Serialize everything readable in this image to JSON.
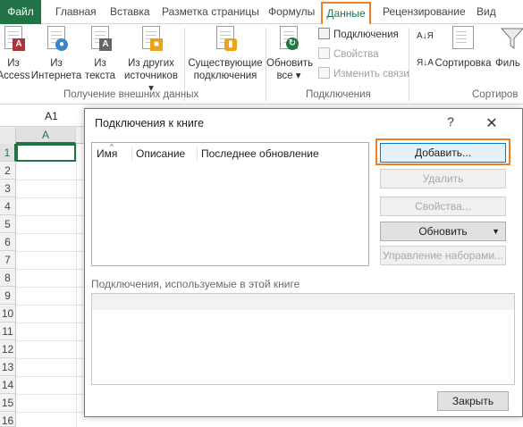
{
  "ribbon_tabs": [
    {
      "label": "Файл"
    },
    {
      "label": "Главная"
    },
    {
      "label": "Вставка"
    },
    {
      "label": "Разметка страницы"
    },
    {
      "label": "Формулы"
    },
    {
      "label": "Данные"
    },
    {
      "label": "Рецензирование"
    },
    {
      "label": "Вид"
    }
  ],
  "ribbon": {
    "external_data": {
      "from_access": {
        "line1": "Из",
        "line2": "Access"
      },
      "from_web": {
        "line1": "Из",
        "line2": "Интернета"
      },
      "from_text": {
        "line1": "Из",
        "line2": "текста"
      },
      "from_other": {
        "line1": "Из других",
        "line2": "источников ▾"
      },
      "existing": {
        "line1": "Существующие",
        "line2": "подключения"
      },
      "group_label": "Получение внешних данных"
    },
    "connections": {
      "refresh_all": {
        "line1": "Обновить",
        "line2": "все ▾"
      },
      "items": [
        "Подключения",
        "Свойства",
        "Изменить связи"
      ],
      "group_label": "Подключения"
    },
    "sort": {
      "az": "А↓Я",
      "za": "Я↓А",
      "sort_label": "Сортировка",
      "filter_label": "Филь",
      "group_label": "Сортиров"
    }
  },
  "sheet": {
    "name_box": "A1",
    "col_header": "A",
    "rows": [
      "1",
      "2",
      "3",
      "4",
      "5",
      "6",
      "7",
      "8",
      "9",
      "10",
      "11",
      "12",
      "13",
      "14",
      "15",
      "16"
    ]
  },
  "dialog": {
    "title": "Подключения к книге",
    "help": "?",
    "close": "✕",
    "columns": [
      "Имя",
      "Описание",
      "Последнее обновление"
    ],
    "buttons": {
      "add": "Добавить...",
      "delete": "Удалить",
      "properties": "Свойства...",
      "refresh": "Обновить",
      "manage_sets": "Управление наборами..."
    },
    "workbook_label": "Подключения, используемые в этой книге",
    "close_button": "Закрыть"
  },
  "colors": {
    "excel_green": "#217346",
    "highlight_orange": "#f07d24"
  }
}
